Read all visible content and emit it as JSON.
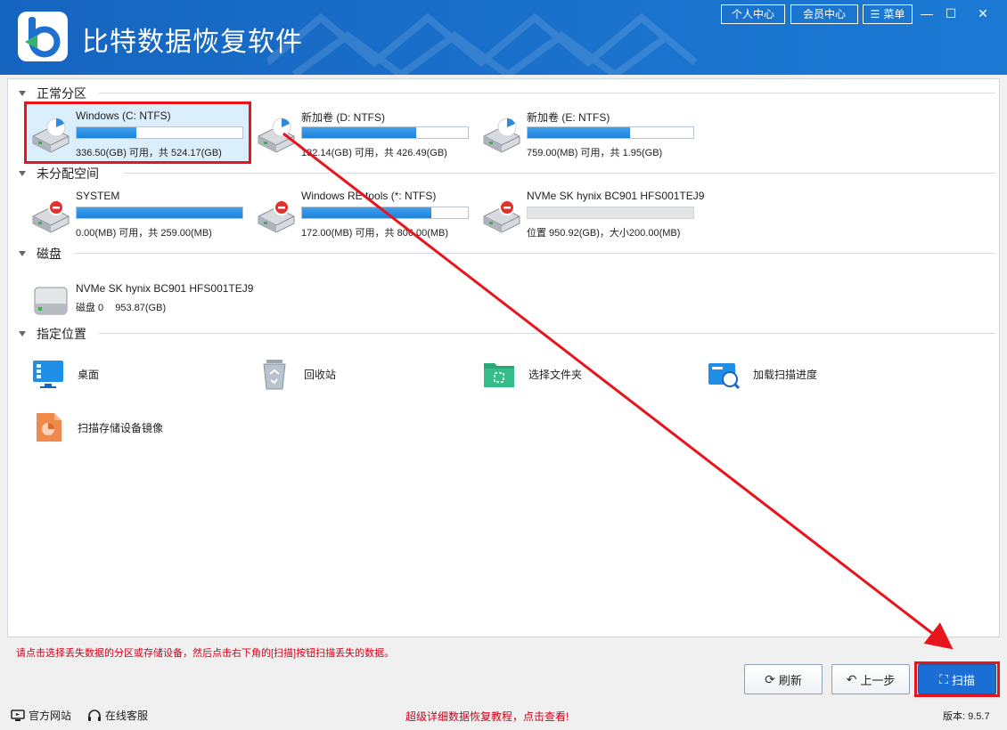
{
  "app": {
    "title": "比特数据恢复软件",
    "buttons": {
      "personal": "个人中心",
      "member": "会员中心",
      "menu": "菜单"
    },
    "window_controls": {
      "minimize": "—",
      "maximize": "☐",
      "close": "✕"
    }
  },
  "sections": {
    "normal": "正常分区",
    "unallocated": "未分配空间",
    "disk": "磁盘",
    "location": "指定位置"
  },
  "normal_partitions": [
    {
      "name": "Windows (C: NTFS)",
      "info": "336.50(GB) 可用，共 524.17(GB)",
      "used_fraction": 0.36
    },
    {
      "name": "新加卷 (D: NTFS)",
      "info": "132.14(GB) 可用，共 426.49(GB)",
      "used_fraction": 0.69
    },
    {
      "name": "新加卷 (E: NTFS)",
      "info": "759.00(MB) 可用，共 1.95(GB)",
      "used_fraction": 0.62
    }
  ],
  "unallocated_partitions": [
    {
      "name": "SYSTEM",
      "info": "0.00(MB) 可用，共 259.00(MB)",
      "used_fraction": 1.0
    },
    {
      "name": "Windows RE tools (*: NTFS)",
      "info": "172.00(MB) 可用，共 806.00(MB)",
      "used_fraction": 0.78
    },
    {
      "name": "NVMe SK hynix BC901 HFS001TEJ9",
      "info": "位置 950.92(GB)，大小200.00(MB)",
      "used_fraction": 0
    }
  ],
  "disks": [
    {
      "name": "NVMe SK hynix BC901 HFS001TEJ9",
      "label": "磁盘 0",
      "size": "953.87(GB)"
    }
  ],
  "locations": [
    {
      "label": "桌面",
      "icon": "desktop-icon"
    },
    {
      "label": "回收站",
      "icon": "recycle-bin-icon"
    },
    {
      "label": "选择文件夹",
      "icon": "folder-icon"
    },
    {
      "label": "加载扫描进度",
      "icon": "load-scan-icon"
    },
    {
      "label": "扫描存储设备镜像",
      "icon": "disk-image-icon"
    }
  ],
  "hint": "请点击选择丢失数据的分区或存储设备，然后点击右下角的[扫描]按钮扫描丢失的数据。",
  "actions": {
    "refresh": "刷新",
    "back": "上一步",
    "scan": "扫描"
  },
  "footer": {
    "website": "官方网站",
    "support": "在线客服",
    "promo": "超级详细数据恢复教程，点击查看!",
    "version": "版本: 9.5.7"
  },
  "colors": {
    "title_bar": "#1a6fcb",
    "accent_red": "#e8141b",
    "progress_blue": "#1e82dc",
    "primary_button": "#1b6ed4"
  }
}
